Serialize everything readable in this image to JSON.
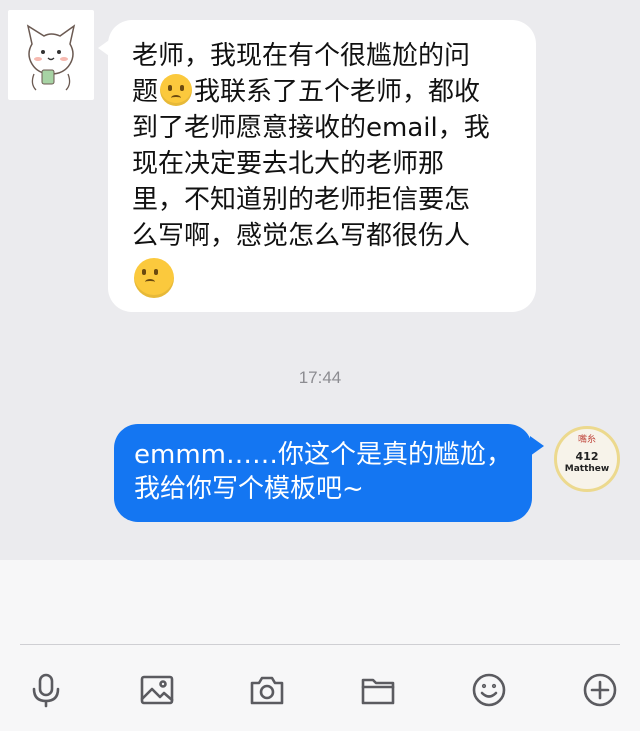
{
  "messages": {
    "incoming": {
      "line1": "老师，我现在有个很尴尬的问",
      "line2_a": "题",
      "line2_b": "我联系了五个老师，都收",
      "line3": "到了老师愿意接收的email，我",
      "line4": "现在决定要去北大的老师那",
      "line5": "里，不知道别的老师拒信要怎",
      "line6": "么写啊，感觉怎么写都很伤人"
    },
    "timestamp": "17:44",
    "outgoing": {
      "line1": "emmm……你这个是真的尴尬，",
      "line2": "我给你写个模板吧~"
    }
  },
  "avatar_right": {
    "top_text": "嘴糸",
    "number": "412",
    "name": "Matthew"
  },
  "toolbar": {
    "icons": [
      "microphone-icon",
      "image-icon",
      "camera-icon",
      "folder-icon",
      "emoji-icon",
      "plus-icon"
    ]
  },
  "colors": {
    "outgoing_bubble": "#1476f2",
    "incoming_bubble": "#ffffff",
    "background": "#ebebee"
  }
}
